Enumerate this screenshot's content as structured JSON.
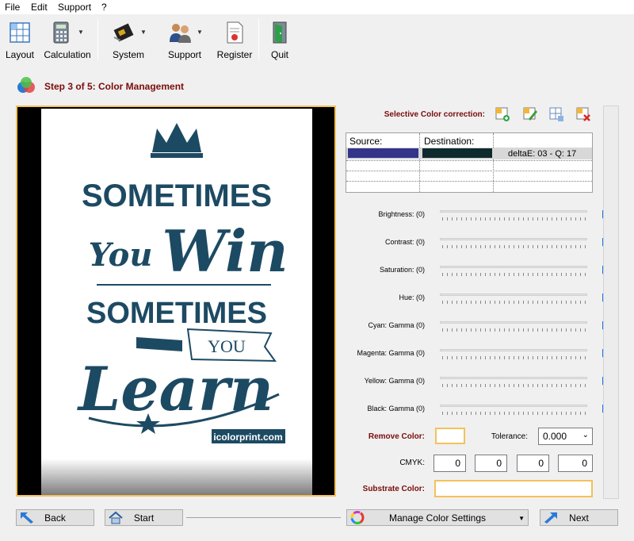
{
  "menu": [
    "File",
    "Edit",
    "Support",
    "?"
  ],
  "toolbar": {
    "layout": "Layout",
    "calculation": "Calculation",
    "system": "System",
    "support": "Support",
    "register": "Register",
    "quit": "Quit"
  },
  "step_title": "Step 3 of 5: Color Management",
  "poster": {
    "line1": "SOMETIMES",
    "line2": "You",
    "line3": "Win",
    "line4": "SOMETIMES",
    "line5": "YOU",
    "line6": "Learn",
    "brand": "icolorprint.com"
  },
  "selective": {
    "title": "Selective Color correction:",
    "source_header": "Source:",
    "destination_header": "Destination:",
    "row1_info": "deltaE: 03 - Q: 17",
    "source_color": "#33348a",
    "destination_color": "#0e2a2c"
  },
  "sliders": [
    {
      "label": "Brightness: (0)"
    },
    {
      "label": "Contrast: (0)"
    },
    {
      "label": "Saturation: (0)"
    },
    {
      "label": "Hue: (0)"
    },
    {
      "label": "Cyan: Gamma  (0)"
    },
    {
      "label": "Magenta: Gamma  (0)"
    },
    {
      "label": "Yellow: Gamma  (0)"
    },
    {
      "label": "Black: Gamma  (0)"
    }
  ],
  "remove_color": {
    "label": "Remove Color:"
  },
  "tolerance": {
    "label": "Tolerance:",
    "value": "0.000"
  },
  "cmyk": {
    "label": "CMYK:",
    "c": "0",
    "m": "0",
    "y": "0",
    "k": "0"
  },
  "substrate": {
    "label": "Substrate Color:"
  },
  "buttons": {
    "back": "Back",
    "start": "Start",
    "manage": "Manage Color Settings",
    "next": "Next"
  },
  "colors": {
    "accent_border": "#f4c15a",
    "title_red": "#7a0c0c",
    "poster_ink": "#1d4a63"
  }
}
